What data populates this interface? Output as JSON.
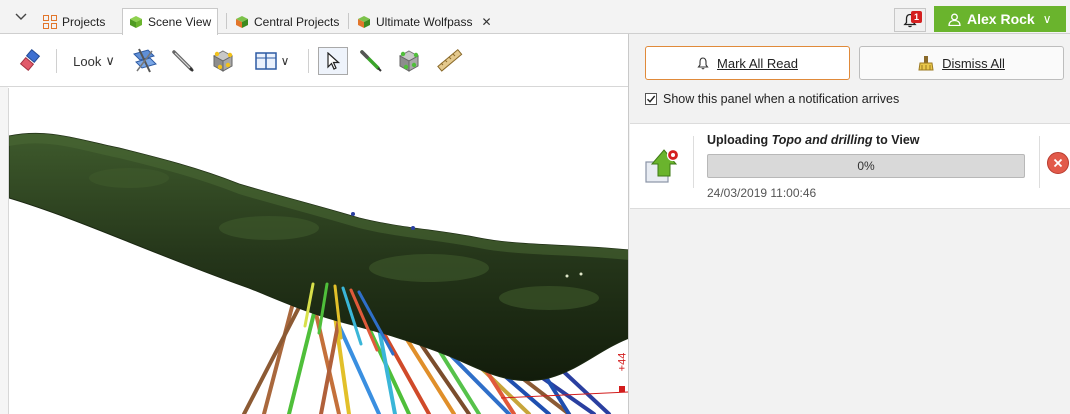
{
  "tabs": {
    "menu_icon": "chevron-down-icon",
    "items": [
      {
        "label": "Projects",
        "icon": "projects-grid-icon"
      },
      {
        "label": "Scene View",
        "icon": "scene-cube-icon",
        "active": true
      },
      {
        "label": "Central Projects",
        "icon": "central-cube-icon"
      },
      {
        "label": "Ultimate Wolfpass",
        "icon": "project-cube-icon",
        "close": "✕"
      }
    ]
  },
  "header": {
    "notification_count": "1",
    "user_name": "Alex Rock",
    "user_chevron": "∨"
  },
  "toolbar": {
    "look_label": "Look",
    "look_chevron": "∨",
    "layout_chevron": "∨"
  },
  "panel": {
    "mark_all_read": "Mark All Read",
    "dismiss_all": "Dismiss All",
    "show_panel_label": "Show this panel when a notification arrives",
    "show_panel_checked": true,
    "notification": {
      "title_prefix": "Uploading ",
      "title_object": "Topo and drilling",
      "title_suffix": " to View",
      "progress_text": "0%",
      "progress_value": 0,
      "timestamp": "24/03/2019 11:00:46"
    }
  },
  "viewport": {
    "axis_label": "+44"
  },
  "colors": {
    "accent_green": "#6ab42d",
    "badge_red": "#d42020",
    "primary_border": "#e08a3a"
  }
}
